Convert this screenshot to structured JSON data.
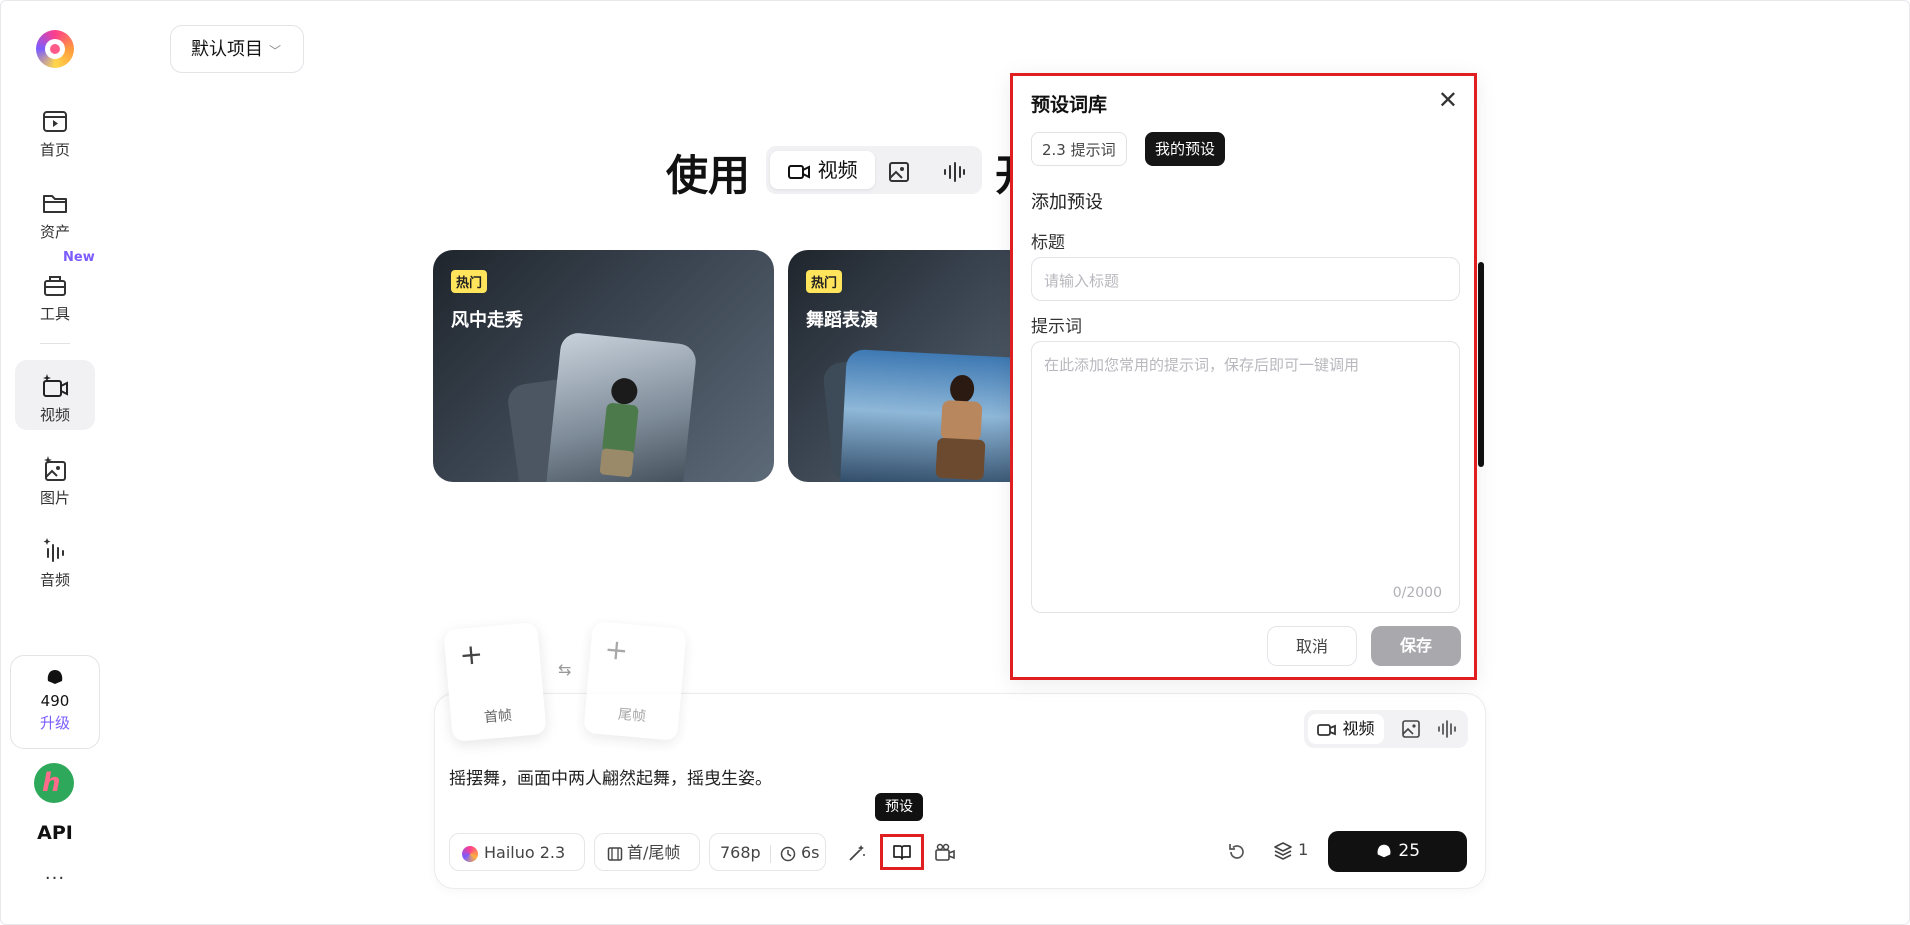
{
  "sidebar": {
    "items": [
      {
        "label": "首页",
        "icon": "home-play-icon"
      },
      {
        "label": "资产",
        "icon": "folder-icon"
      },
      {
        "label": "工具",
        "icon": "toolbox-icon"
      },
      {
        "label": "视频",
        "icon": "video-sparkle-icon"
      },
      {
        "label": "图片",
        "icon": "image-sparkle-icon"
      },
      {
        "label": "音频",
        "icon": "audio-sparkle-icon"
      }
    ],
    "new_badge": "New",
    "credits": "490",
    "upgrade": "升级",
    "api": "API",
    "more": "···"
  },
  "header": {
    "project": "默认项目"
  },
  "hero": {
    "title_start": "使用",
    "title_end": "开",
    "mode_video": "视频"
  },
  "cards": [
    {
      "tag": "热门",
      "title": "风中走秀"
    },
    {
      "tag": "热门",
      "title": "舞蹈表演"
    }
  ],
  "composer": {
    "first_frame": "首帧",
    "last_frame": "尾帧",
    "prompt": "摇摆舞，画面中两人翩然起舞，摇曳生姿。",
    "mode_video": "视频",
    "model": "Hailuo 2.3",
    "frames": "首/尾帧",
    "resolution": "768p",
    "duration": "6s",
    "tooltip": "预设",
    "count": "1",
    "cost": "25"
  },
  "dialog": {
    "title": "预设词库",
    "tab_prompts": "2.3 提示词",
    "tab_mine": "我的预设",
    "section": "添加预设",
    "title_label": "标题",
    "title_placeholder": "请输入标题",
    "prompt_label": "提示词",
    "prompt_placeholder": "在此添加您常用的提示词，保存后即可一键调用",
    "counter": "0/2000",
    "cancel": "取消",
    "save": "保存"
  },
  "colors": {
    "accent": "#7c5cff",
    "highlight": "#e02020",
    "dark": "#111111"
  }
}
